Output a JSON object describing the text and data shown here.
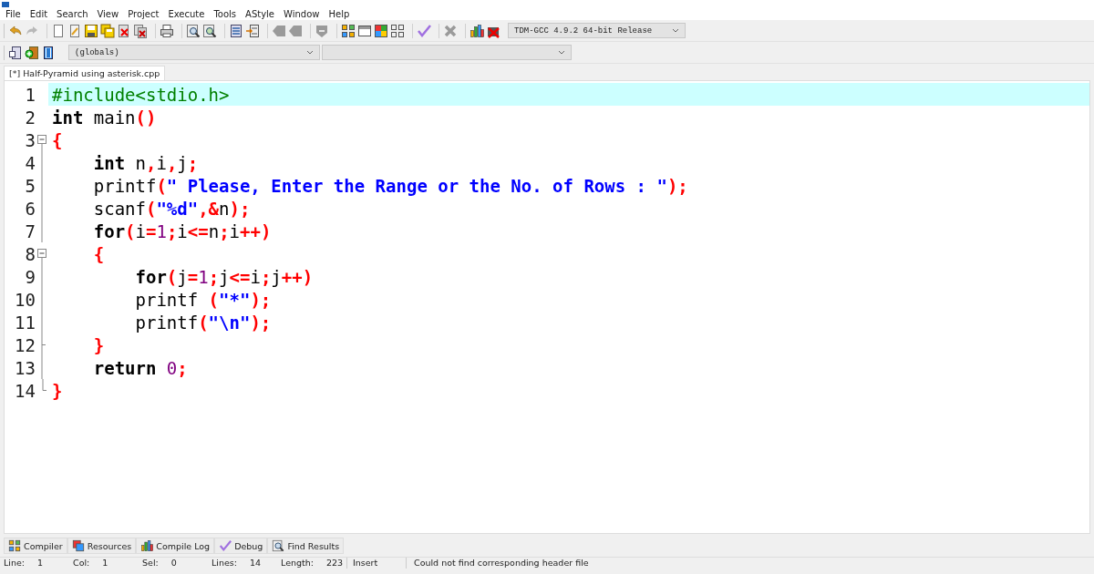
{
  "menu": [
    "File",
    "Edit",
    "Search",
    "View",
    "Project",
    "Execute",
    "Tools",
    "AStyle",
    "Window",
    "Help"
  ],
  "compiler_select": {
    "value": "TDM-GCC 4.9.2 64-bit Release"
  },
  "scope_select": {
    "value": "(globals)"
  },
  "tabs": [
    {
      "label": "[*] Half-Pyramid using asterisk.cpp",
      "selected": true
    }
  ],
  "editor": {
    "lines": [
      {
        "number": "1",
        "selected": true,
        "kind": "plain",
        "tokens": [
          {
            "kind": "pre",
            "text": "#include<stdio.h>"
          }
        ]
      },
      {
        "number": "2",
        "selected": false,
        "kind": "plain",
        "tokens": [
          {
            "kind": "kw",
            "text": "int"
          },
          {
            "kind": "plain",
            "text": " main"
          },
          {
            "kind": "op",
            "text": "()"
          }
        ]
      },
      {
        "number": "3",
        "selected": false,
        "kind": "open",
        "tokens": [
          {
            "kind": "op",
            "text": "{"
          }
        ]
      },
      {
        "number": "4",
        "selected": false,
        "kind": "line",
        "tokens": [
          {
            "kind": "kw",
            "text": "    int"
          },
          {
            "kind": "plain",
            "text": " n"
          },
          {
            "kind": "op",
            "text": ","
          },
          {
            "kind": "plain",
            "text": "i"
          },
          {
            "kind": "op",
            "text": ","
          },
          {
            "kind": "plain",
            "text": "j"
          },
          {
            "kind": "op",
            "text": ";"
          }
        ]
      },
      {
        "number": "5",
        "selected": false,
        "kind": "line",
        "tokens": [
          {
            "kind": "plain",
            "text": "    printf"
          },
          {
            "kind": "op",
            "text": "("
          },
          {
            "kind": "str",
            "text": "\" Please, Enter the Range or the No. of Rows : \""
          },
          {
            "kind": "op",
            "text": ");"
          }
        ]
      },
      {
        "number": "6",
        "selected": false,
        "kind": "line",
        "tokens": [
          {
            "kind": "plain",
            "text": "    scanf"
          },
          {
            "kind": "op",
            "text": "("
          },
          {
            "kind": "str",
            "text": "\"%d\""
          },
          {
            "kind": "op",
            "text": ",&"
          },
          {
            "kind": "plain",
            "text": "n"
          },
          {
            "kind": "op",
            "text": ");"
          }
        ]
      },
      {
        "number": "7",
        "selected": false,
        "kind": "line",
        "tokens": [
          {
            "kind": "kw",
            "text": "    for"
          },
          {
            "kind": "op",
            "text": "("
          },
          {
            "kind": "plain",
            "text": "i"
          },
          {
            "kind": "op",
            "text": "="
          },
          {
            "kind": "num",
            "text": "1"
          },
          {
            "kind": "op",
            "text": ";"
          },
          {
            "kind": "plain",
            "text": "i"
          },
          {
            "kind": "op",
            "text": "<="
          },
          {
            "kind": "plain",
            "text": "n"
          },
          {
            "kind": "op",
            "text": ";"
          },
          {
            "kind": "plain",
            "text": "i"
          },
          {
            "kind": "op",
            "text": "++)"
          }
        ]
      },
      {
        "number": "8",
        "selected": false,
        "kind": "open",
        "tokens": [
          {
            "kind": "op",
            "text": "    {"
          }
        ]
      },
      {
        "number": "9",
        "selected": false,
        "kind": "line",
        "tokens": [
          {
            "kind": "kw",
            "text": "        for"
          },
          {
            "kind": "op",
            "text": "("
          },
          {
            "kind": "plain",
            "text": "j"
          },
          {
            "kind": "op",
            "text": "="
          },
          {
            "kind": "num",
            "text": "1"
          },
          {
            "kind": "op",
            "text": ";"
          },
          {
            "kind": "plain",
            "text": "j"
          },
          {
            "kind": "op",
            "text": "<="
          },
          {
            "kind": "plain",
            "text": "i"
          },
          {
            "kind": "op",
            "text": ";"
          },
          {
            "kind": "plain",
            "text": "j"
          },
          {
            "kind": "op",
            "text": "++)"
          }
        ]
      },
      {
        "number": "10",
        "selected": false,
        "kind": "line",
        "tokens": [
          {
            "kind": "plain",
            "text": "        printf "
          },
          {
            "kind": "op",
            "text": "("
          },
          {
            "kind": "str",
            "text": "\"*\""
          },
          {
            "kind": "op",
            "text": ");"
          }
        ]
      },
      {
        "number": "11",
        "selected": false,
        "kind": "line",
        "tokens": [
          {
            "kind": "plain",
            "text": "        printf"
          },
          {
            "kind": "op",
            "text": "("
          },
          {
            "kind": "str",
            "text": "\"\\n\""
          },
          {
            "kind": "op",
            "text": ");"
          }
        ]
      },
      {
        "number": "12",
        "selected": false,
        "kind": "close",
        "tokens": [
          {
            "kind": "op",
            "text": "    }"
          }
        ]
      },
      {
        "number": "13",
        "selected": false,
        "kind": "line",
        "tokens": [
          {
            "kind": "kw",
            "text": "    return"
          },
          {
            "kind": "num",
            "text": " 0"
          },
          {
            "kind": "op",
            "text": ";"
          }
        ]
      },
      {
        "number": "14",
        "selected": false,
        "kind": "end",
        "tokens": [
          {
            "kind": "op",
            "text": "}"
          }
        ]
      }
    ]
  },
  "bottom_tabs": [
    {
      "label": "Compiler"
    },
    {
      "label": "Resources"
    },
    {
      "label": "Compile Log"
    },
    {
      "label": "Debug"
    },
    {
      "label": "Find Results"
    }
  ],
  "status_bar": {
    "fields": [
      {
        "label": "Line:",
        "value": "1"
      },
      {
        "label": "Col:",
        "value": "1"
      },
      {
        "label": "Sel:",
        "value": "0"
      },
      {
        "label": "Lines:",
        "value": "14"
      },
      {
        "label": "Length:",
        "value": "223"
      }
    ],
    "mode": "Insert",
    "message": "Could not find corresponding header file"
  }
}
